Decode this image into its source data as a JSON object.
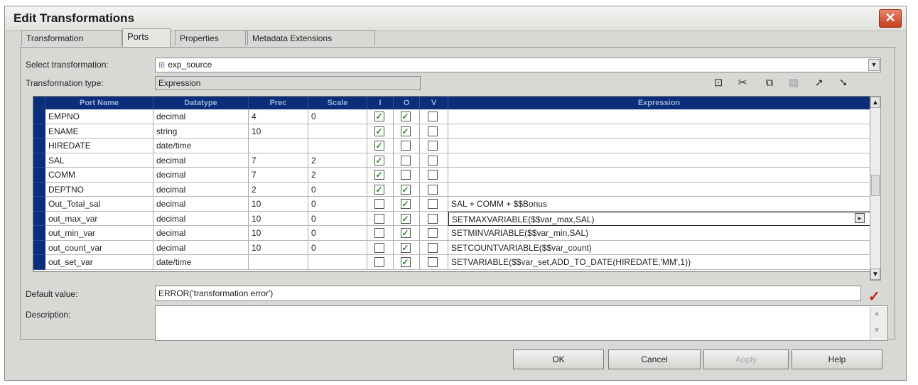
{
  "dialog": {
    "title": "Edit Transformations",
    "close_icon": "close-icon"
  },
  "tabs": [
    "Transformation",
    "Ports",
    "Properties",
    "Metadata Extensions"
  ],
  "active_tab": "Ports",
  "select_transformation": {
    "label": "Select transformation:",
    "value": "exp_source"
  },
  "transformation_type": {
    "label": "Transformation type:",
    "value": "Expression"
  },
  "toolbar_icons": [
    "new-port-icon",
    "cut-icon",
    "copy-icon",
    "paste-icon",
    "move-up-icon",
    "move-down-icon"
  ],
  "columns": [
    "Port Name",
    "Datatype",
    "Prec",
    "Scale",
    "I",
    "O",
    "V",
    "Expression"
  ],
  "rows": [
    {
      "name": "EMPNO",
      "datatype": "decimal",
      "prec": "4",
      "scale": "0",
      "i": true,
      "o": true,
      "v": false,
      "expr": ""
    },
    {
      "name": "ENAME",
      "datatype": "string",
      "prec": "10",
      "scale": "",
      "i": true,
      "o": true,
      "v": false,
      "expr": ""
    },
    {
      "name": "HIREDATE",
      "datatype": "date/time",
      "prec": "",
      "scale": "",
      "i": true,
      "o": false,
      "v": false,
      "expr": ""
    },
    {
      "name": "SAL",
      "datatype": "decimal",
      "prec": "7",
      "scale": "2",
      "i": true,
      "o": false,
      "v": false,
      "expr": ""
    },
    {
      "name": "COMM",
      "datatype": "decimal",
      "prec": "7",
      "scale": "2",
      "i": true,
      "o": false,
      "v": false,
      "expr": ""
    },
    {
      "name": "DEPTNO",
      "datatype": "decimal",
      "prec": "2",
      "scale": "0",
      "i": true,
      "o": true,
      "v": false,
      "expr": ""
    },
    {
      "name": "Out_Total_sal",
      "datatype": "decimal",
      "prec": "10",
      "scale": "0",
      "i": false,
      "o": true,
      "v": false,
      "expr": "SAL + COMM + $$Bonus"
    },
    {
      "name": "out_max_var",
      "datatype": "decimal",
      "prec": "10",
      "scale": "0",
      "i": false,
      "o": true,
      "v": false,
      "expr": "SETMAXVARIABLE($$var_max,SAL)"
    },
    {
      "name": "out_min_var",
      "datatype": "decimal",
      "prec": "10",
      "scale": "0",
      "i": false,
      "o": true,
      "v": false,
      "expr": "SETMINVARIABLE($$var_min,SAL)"
    },
    {
      "name": "out_count_var",
      "datatype": "decimal",
      "prec": "10",
      "scale": "0",
      "i": false,
      "o": true,
      "v": false,
      "expr": "SETCOUNTVARIABLE($$var_count)"
    },
    {
      "name": "out_set_var",
      "datatype": "date/time",
      "prec": "",
      "scale": "",
      "i": false,
      "o": true,
      "v": false,
      "expr": "SETVARIABLE($$var_set,ADD_TO_DATE(HIREDATE,'MM',1))"
    }
  ],
  "default_value": {
    "label": "Default value:",
    "value": "ERROR('transformation error')"
  },
  "description": {
    "label": "Description:",
    "value": ""
  },
  "buttons": {
    "ok": "OK",
    "cancel": "Cancel",
    "apply": "Apply",
    "help": "Help"
  }
}
